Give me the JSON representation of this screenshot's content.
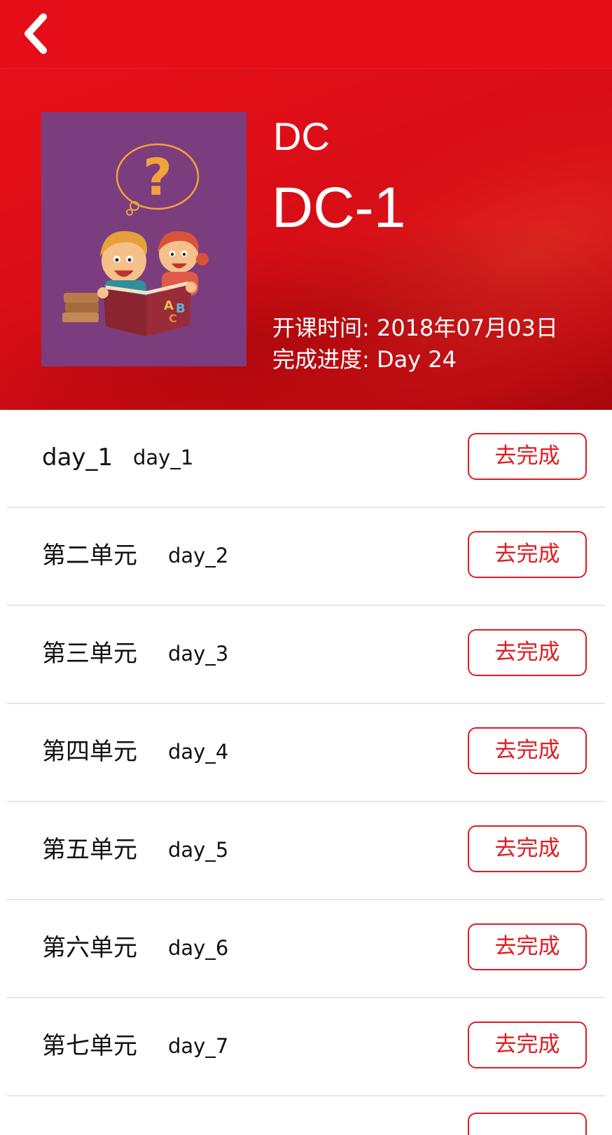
{
  "header": {
    "back_icon": "chevron-left-icon",
    "course_category": "DC",
    "course_name": "DC-1",
    "start_time": "开课时间: 2018年07月03日",
    "progress": "完成进度: Day 24",
    "accent_color": "#e50d17"
  },
  "units": [
    {
      "title": "day_1",
      "subtitle": "day_1",
      "button": "去完成"
    },
    {
      "title": "第二单元",
      "subtitle": "day_2",
      "button": "去完成"
    },
    {
      "title": "第三单元",
      "subtitle": "day_3",
      "button": "去完成"
    },
    {
      "title": "第四单元",
      "subtitle": "day_4",
      "button": "去完成"
    },
    {
      "title": "第五单元",
      "subtitle": "day_5",
      "button": "去完成"
    },
    {
      "title": "第六单元",
      "subtitle": "day_6",
      "button": "去完成"
    },
    {
      "title": "第七单元",
      "subtitle": "day_7",
      "button": "去完成"
    }
  ]
}
